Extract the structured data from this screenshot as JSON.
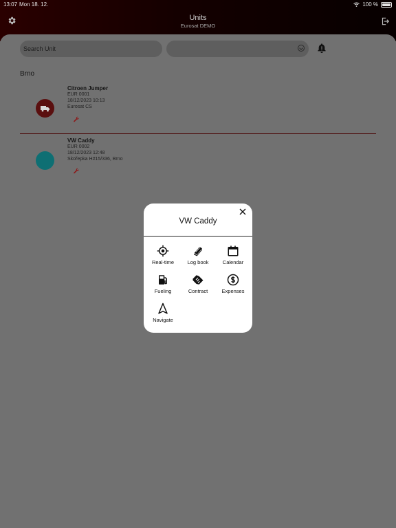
{
  "status_bar": {
    "time": "13:07",
    "date": "Mon 18. 12.",
    "battery": "100 %"
  },
  "header": {
    "title": "Units",
    "subtitle": "Eurosat DEMO"
  },
  "search": {
    "placeholder": "Search Unit"
  },
  "group": {
    "name": "Brno"
  },
  "units": [
    {
      "name": "Citroen Jumper",
      "plate": "EUR 0001",
      "timestamp": "18/12/2023 10:13",
      "location": "Eurosat CS",
      "avatar_color": "#5a0f0f"
    },
    {
      "name": "VW Caddy",
      "plate": "EUR 0002",
      "timestamp": "18/12/2023 12:48",
      "location": "Skořepka H#15/336, Brno",
      "avatar_color": "#0e6f73"
    }
  ],
  "modal": {
    "title": "VW Caddy",
    "actions": [
      {
        "label": "Real-time",
        "icon": "target-icon"
      },
      {
        "label": "Log book",
        "icon": "book-icon"
      },
      {
        "label": "Calendar",
        "icon": "calendar-icon"
      },
      {
        "label": "Fueling",
        "icon": "fuel-pump-icon"
      },
      {
        "label": "Contract",
        "icon": "handshake-icon"
      },
      {
        "label": "Expenses",
        "icon": "dollar-icon"
      },
      {
        "label": "Navigate",
        "icon": "navigate-arrow-icon"
      }
    ]
  },
  "colors": {
    "header_dark": "#140000",
    "overlay": "#6d6d6d",
    "accent_red": "#9b1b1b",
    "teal": "#0e6f73"
  }
}
